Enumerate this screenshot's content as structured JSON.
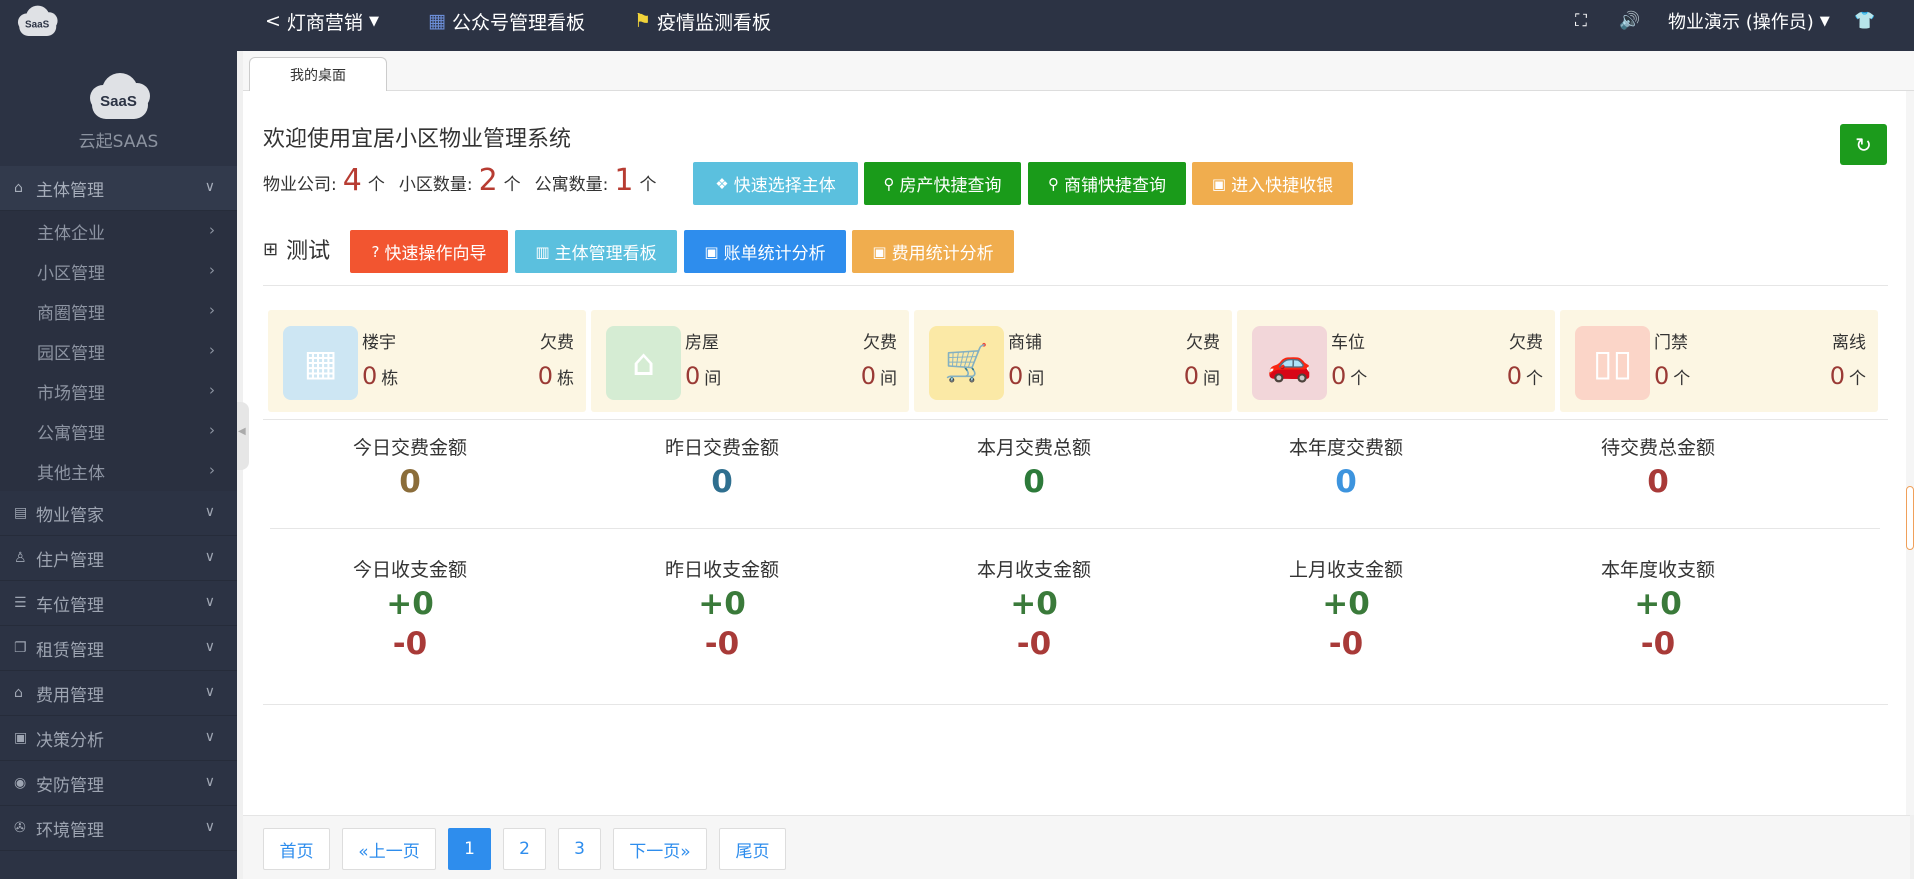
{
  "topbar": {
    "logo_text": "SaaS",
    "nav": [
      {
        "label": "灯商营销",
        "icon": "share-icon"
      },
      {
        "label": "公众号管理看板",
        "icon": "dashboard-icon"
      },
      {
        "label": "疫情监测看板",
        "icon": "flag-icon"
      }
    ],
    "user": "物业演示 (操作员)"
  },
  "sidebar": {
    "logo_text": "SaaS",
    "brand": "云起SAAS",
    "groups": [
      {
        "label": "主体管理",
        "icon": "home-icon"
      },
      {
        "label": "物业管家",
        "icon": "book-icon"
      },
      {
        "label": "住户管理",
        "icon": "user-icon"
      },
      {
        "label": "车位管理",
        "icon": "list-icon"
      },
      {
        "label": "租赁管理",
        "icon": "copy-icon"
      },
      {
        "label": "费用管理",
        "icon": "bank-icon"
      },
      {
        "label": "决策分析",
        "icon": "truck-icon"
      },
      {
        "label": "安防管理",
        "icon": "eye-icon"
      },
      {
        "label": "环境管理",
        "icon": "gamepad-icon"
      }
    ],
    "sub_items": [
      "主体企业",
      "小区管理",
      "商圈管理",
      "园区管理",
      "市场管理",
      "公寓管理",
      "其他主体"
    ]
  },
  "tabs": {
    "home": "我的桌面"
  },
  "welcome": {
    "title": "欢迎使用宜居小区物业管理系统",
    "companies_label": "物业公司:",
    "companies_value": "4",
    "communities_label": "小区数量:",
    "communities_value": "2",
    "apartments_label": "公寓数量:",
    "apartments_value": "1",
    "unit": "个"
  },
  "quick_buttons": {
    "select_subject": "快速选择主体",
    "house_query": "房产快捷查询",
    "shop_query": "商铺快捷查询",
    "cashier": "进入快捷收银"
  },
  "section": {
    "title": "测试",
    "guide": "快速操作向导",
    "subject_board": "主体管理看板",
    "bill_analysis": "账单统计分析",
    "fee_analysis": "费用统计分析"
  },
  "cards": [
    {
      "label": "楼宇",
      "right_label": "欠费",
      "value": "0",
      "unit": "栋",
      "right_value": "0",
      "right_unit": "栋",
      "icon": "building-icon",
      "color": "#cde6f3"
    },
    {
      "label": "房屋",
      "right_label": "欠费",
      "value": "0",
      "unit": "间",
      "right_value": "0",
      "right_unit": "间",
      "icon": "house-icon",
      "color": "#d5ecd3"
    },
    {
      "label": "商铺",
      "right_label": "欠费",
      "value": "0",
      "unit": "间",
      "right_value": "0",
      "right_unit": "间",
      "icon": "cart-icon",
      "color": "#fbe9a6"
    },
    {
      "label": "车位",
      "right_label": "欠费",
      "value": "0",
      "unit": "个",
      "right_value": "0",
      "right_unit": "个",
      "icon": "car-icon",
      "color": "#f2d6d9"
    },
    {
      "label": "门禁",
      "right_label": "离线",
      "value": "0",
      "unit": "个",
      "right_value": "0",
      "right_unit": "个",
      "icon": "door-icon",
      "color": "#fbd5c8"
    }
  ],
  "payments": [
    {
      "label": "今日交费金额",
      "value": "0",
      "color": "#8b6d3a"
    },
    {
      "label": "昨日交费金额",
      "value": "0",
      "color": "#2f6f8f"
    },
    {
      "label": "本月交费总额",
      "value": "0",
      "color": "#2d7a3a"
    },
    {
      "label": "本年度交费额",
      "value": "0",
      "color": "#3d94de"
    },
    {
      "label": "待交费总金额",
      "value": "0",
      "color": "#a83a38"
    }
  ],
  "balances": [
    {
      "label": "今日收支金额",
      "plus": "+0",
      "minus": "-0"
    },
    {
      "label": "昨日收支金额",
      "plus": "+0",
      "minus": "-0"
    },
    {
      "label": "本月收支金额",
      "plus": "+0",
      "minus": "-0"
    },
    {
      "label": "上月收支金额",
      "plus": "+0",
      "minus": "-0"
    },
    {
      "label": "本年度收支额",
      "plus": "+0",
      "minus": "-0"
    }
  ],
  "pager": {
    "first": "首页",
    "prev": "«上一页",
    "p1": "1",
    "p2": "2",
    "p3": "3",
    "next": "下一页»",
    "last": "尾页"
  },
  "colors": {
    "plus": "#3a7a3a",
    "minus": "#a83a38",
    "sidebar_bg": "#2c3344",
    "green": "#1a9b1a"
  }
}
